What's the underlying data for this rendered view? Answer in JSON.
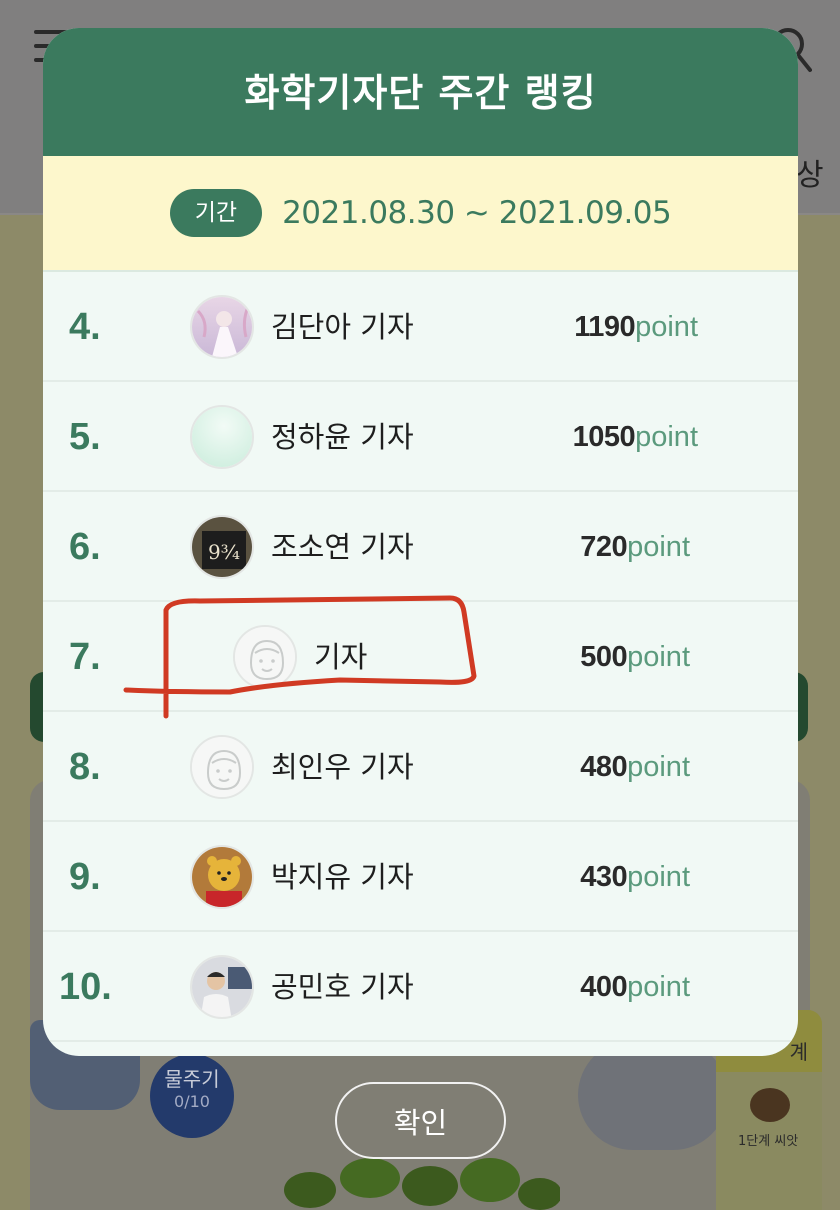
{
  "modal": {
    "title": "화학기자단 주간 랭킹",
    "period_label": "기간",
    "period_range": "2021.08.30 ~ 2021.09.05"
  },
  "rankings": [
    {
      "rank": "4.",
      "name": "김단아 기자",
      "points": "1190",
      "unit": "point",
      "avatar": "profile-photo"
    },
    {
      "rank": "5.",
      "name": "정하윤 기자",
      "points": "1050",
      "unit": "point",
      "avatar": "mint-gradient"
    },
    {
      "rank": "6.",
      "name": "조소연 기자",
      "points": "720",
      "unit": "point",
      "avatar": "platform-sign-photo"
    },
    {
      "rank": "7.",
      "name": "기자",
      "points": "500",
      "unit": "point",
      "avatar": "default-face"
    },
    {
      "rank": "8.",
      "name": "최인우 기자",
      "points": "480",
      "unit": "point",
      "avatar": "default-face"
    },
    {
      "rank": "9.",
      "name": "박지유 기자",
      "points": "430",
      "unit": "point",
      "avatar": "bear-character-photo"
    },
    {
      "rank": "10.",
      "name": "공민호 기자",
      "points": "400",
      "unit": "point",
      "avatar": "person-photo"
    }
  ],
  "confirm_label": "확인",
  "background": {
    "watering_label": "물주기",
    "watering_count": "0/10",
    "stage_tab": "계",
    "seed_label": "1단계 씨앗",
    "nav_char": "상"
  },
  "colors": {
    "primary_green": "#3b7a5e",
    "period_bg": "#fdf7cc",
    "list_bg": "#f1f9f5",
    "annotation_red": "#d03a23"
  }
}
